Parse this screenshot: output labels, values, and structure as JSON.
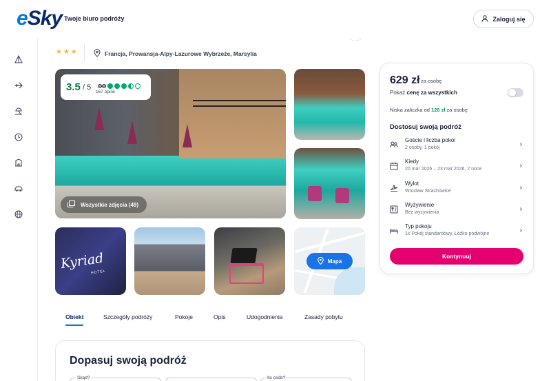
{
  "header": {
    "logo_text": "eSky",
    "tagline": "Twoje biuro podróży",
    "login_label": "Zaloguj się"
  },
  "sidebar": {
    "items": [
      {
        "icon": "tent-icon"
      },
      {
        "icon": "plane-icon"
      },
      {
        "icon": "beach-icon"
      },
      {
        "icon": "clock-icon"
      },
      {
        "icon": "hotel-icon"
      },
      {
        "icon": "car-icon"
      },
      {
        "icon": "globe-icon"
      }
    ]
  },
  "hotel": {
    "stars": "★★★",
    "location": "Francja, Prowansja-Alpy-Lazurowe Wybrzeże, Marsylia",
    "rating": {
      "score": "3.5",
      "scale": "/ 5",
      "reviews": "167 opinii",
      "dots_filled": 3,
      "dots_total": 5
    },
    "all_photos_label": "Wszystkie zdjęcia (49)",
    "map_label": "Mapa",
    "brand_sign": "Kyriad",
    "brand_sign_sub": "HOTEL"
  },
  "tabs": [
    {
      "label": "Obiekt",
      "active": true
    },
    {
      "label": "Szczegóły podróży"
    },
    {
      "label": "Pokoje"
    },
    {
      "label": "Opis"
    },
    {
      "label": "Udogodnienia"
    },
    {
      "label": "Zasady pobytu"
    }
  ],
  "customize_section": {
    "title": "Dopasuj swoją podróż",
    "fields": [
      {
        "label": "Skąd?"
      },
      {
        "label": ""
      },
      {
        "label": "Ile osób?"
      }
    ]
  },
  "booking": {
    "price": "629 zł",
    "price_per": "za osobę",
    "show_total_prefix": "Pokaż ",
    "show_total_bold": "cenę za wszystkich",
    "deposit_prefix": "Niska zaliczka od ",
    "deposit_amount": "126 zł",
    "deposit_suffix": " za osobę",
    "customize_title": "Dostosuj swoją podróż",
    "options": [
      {
        "title": "Goście i liczba pokoi",
        "value": "2 osoby, 1 pokój",
        "icon": "users-icon"
      },
      {
        "title": "Kiedy",
        "value": "20 mar 2026 – 23 mar 2026, 2 noce",
        "icon": "calendar-icon"
      },
      {
        "title": "Wylot",
        "value": "Wrocław Strachowice",
        "icon": "departure-icon"
      },
      {
        "title": "Wyżywienie",
        "value": "Bez wyżywienia",
        "icon": "meal-icon"
      },
      {
        "title": "Typ pokoju",
        "value": "1x Pokój standardowy, Łóżko podwójne",
        "icon": "bed-icon"
      }
    ],
    "continue_label": "Kontynuuj"
  },
  "colors": {
    "accent_blue": "#0a7bd6",
    "brand_navy": "#0a2a6b",
    "cta_pink": "#e4006f",
    "rating_green": "#00aa6c",
    "deposit_green": "#0b9a5b"
  }
}
